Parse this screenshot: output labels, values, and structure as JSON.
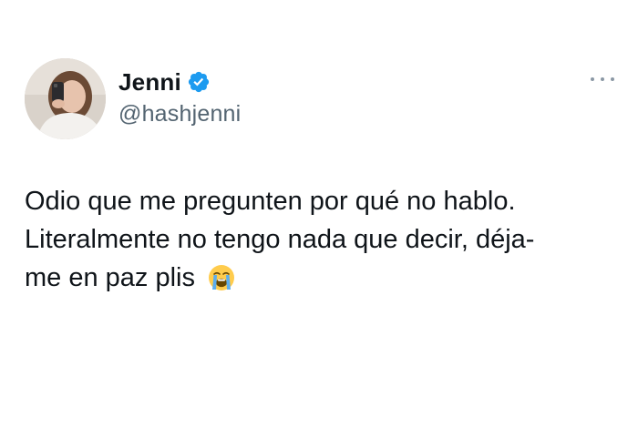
{
  "user": {
    "display_name": "Jenni",
    "handle": "@hashjenni",
    "verified": true,
    "verified_icon": "verified-badge-icon",
    "avatar_icon": "avatar-photo"
  },
  "menu": {
    "more_icon": "more-horizontal-icon"
  },
  "tweet": {
    "lines": [
      "Odio que me pregunten por qué no hablo.",
      "Literalmente no tengo nada que decir, déja-",
      "me en paz plis"
    ],
    "emoji": "loudly-crying-face-icon"
  },
  "colors": {
    "verified_blue": "#1d9bf0",
    "text": "#0f1419",
    "secondary_text": "#536471"
  }
}
